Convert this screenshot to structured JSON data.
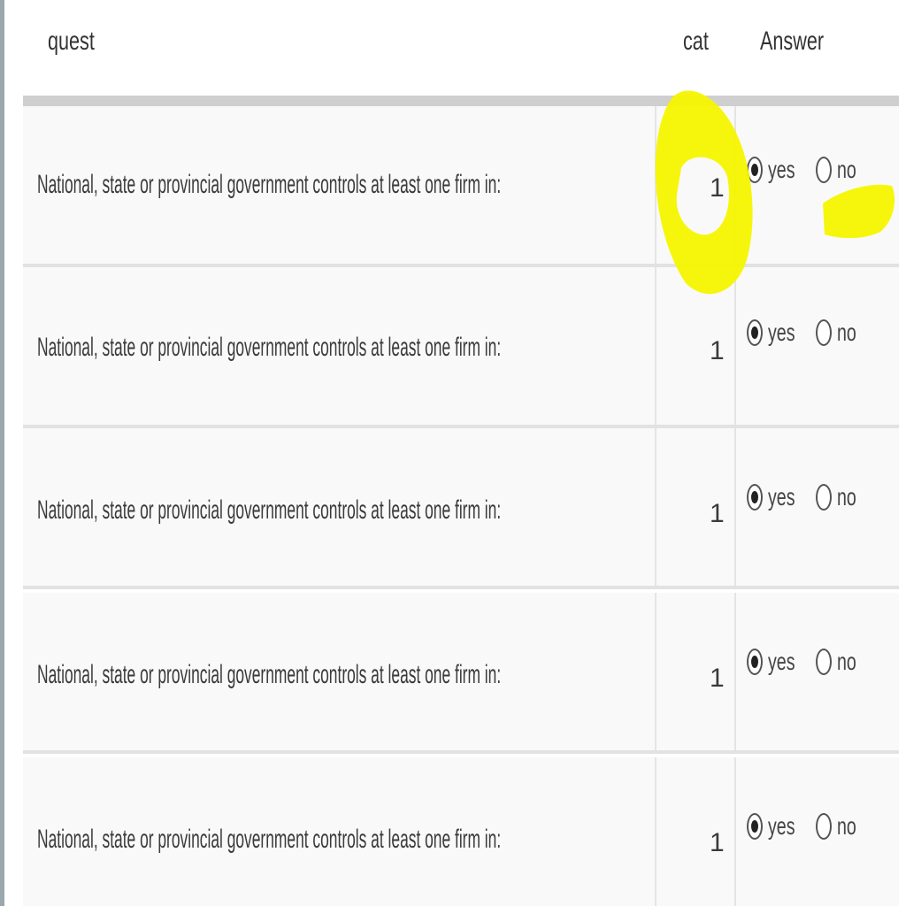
{
  "table": {
    "columns": {
      "quest": "quest",
      "cat": "cat",
      "answer": "Answer"
    },
    "rows": [
      {
        "question": "National, state or provincial government controls at least one firm in:",
        "cat": "1",
        "yes_label": "yes",
        "no_label": "no",
        "selected": "yes"
      },
      {
        "question": "National, state or provincial government controls at least one firm in:",
        "cat": "1",
        "yes_label": "yes",
        "no_label": "no",
        "selected": "yes"
      },
      {
        "question": "National, state or provincial government controls at least one firm in:",
        "cat": "1",
        "yes_label": "yes",
        "no_label": "no",
        "selected": "yes"
      },
      {
        "question": "National, state or provincial government controls at least one firm in:",
        "cat": "1",
        "yes_label": "yes",
        "no_label": "no",
        "selected": "yes"
      },
      {
        "question": "National, state or provincial government controls at least one firm in:",
        "cat": "1",
        "yes_label": "yes",
        "no_label": "no",
        "selected": "yes"
      }
    ]
  },
  "annotations": {
    "highlight_color": "#f5f500"
  },
  "colors": {
    "row_bg": "#f9f9f9",
    "header_rule": "#cfcfcf",
    "left_rule": "#9aa7ad"
  }
}
